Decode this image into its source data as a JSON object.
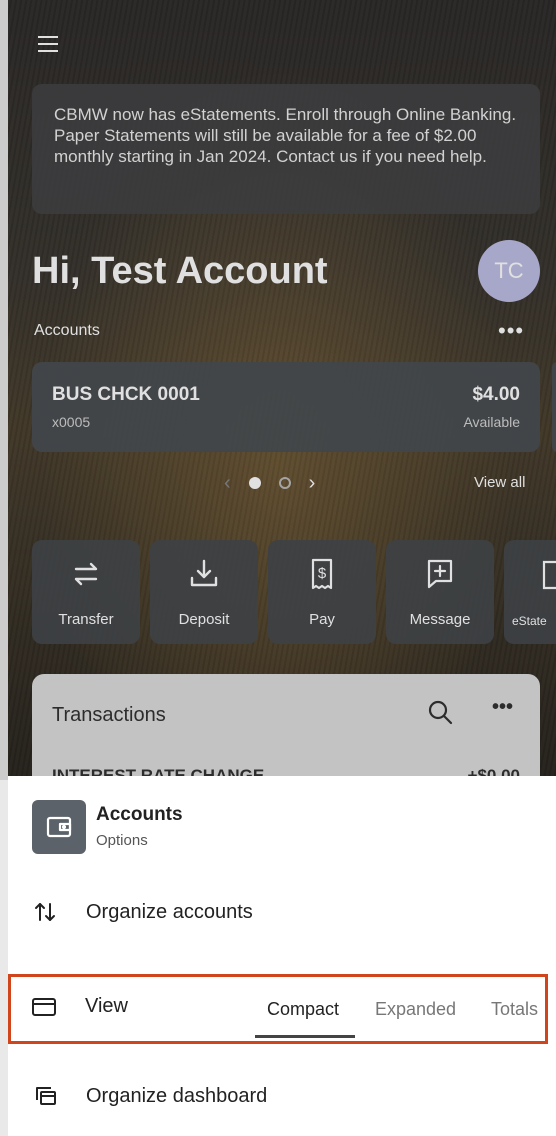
{
  "banner": {
    "text": "CBMW now has eStatements. Enroll through Online Banking. Paper Statements will still be available for a fee of $2.00 monthly starting in Jan 2024. Contact us if you need help."
  },
  "header": {
    "greeting": "Hi, Test Account",
    "avatar_initials": "TC"
  },
  "accounts": {
    "label": "Accounts",
    "more": "•••",
    "card": {
      "name": "BUS CHCK 0001",
      "number": "x0005",
      "balance": "$4.00",
      "balance_label": "Available"
    },
    "pager": {
      "prev": "‹",
      "next": "›",
      "view_all": "View all"
    }
  },
  "actions": [
    {
      "label": "Transfer",
      "icon": "transfer-icon"
    },
    {
      "label": "Deposit",
      "icon": "deposit-icon"
    },
    {
      "label": "Pay",
      "icon": "pay-icon"
    },
    {
      "label": "Message",
      "icon": "message-icon"
    },
    {
      "label": "eState",
      "icon": "estatement-icon"
    }
  ],
  "transactions": {
    "title": "Transactions",
    "more": "•••",
    "row_label": "INTEREST RATE CHANGE",
    "row_amount": "+$0.00"
  },
  "sheet": {
    "title": "Accounts",
    "subtitle": "Options",
    "organize_accounts": "Organize accounts",
    "view_label": "View",
    "view_options": [
      "Compact",
      "Expanded",
      "Totals"
    ],
    "view_selected": "Compact",
    "organize_dashboard": "Organize dashboard"
  },
  "colors": {
    "highlight": "#d0451b",
    "avatar": "#bfbfe6",
    "sheet_icon_bg": "#5c6269"
  }
}
